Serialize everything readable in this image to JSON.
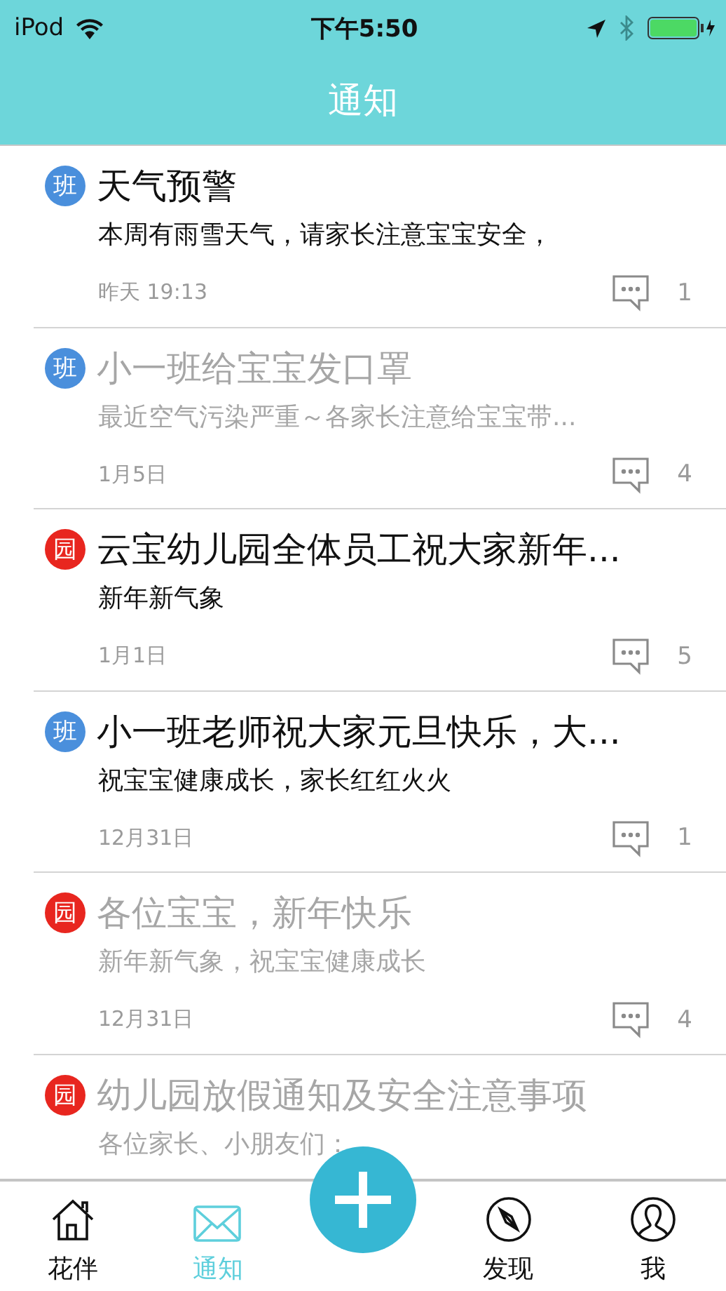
{
  "status_bar": {
    "carrier": "iPod",
    "time": "下午5:50"
  },
  "header": {
    "title": "通知"
  },
  "notices": [
    {
      "badge": "班",
      "color": "#4a8fdc",
      "read": false,
      "title": "天气预警",
      "body": "本周有雨雪天气，请家长注意宝宝安全，",
      "date": "昨天 19:13",
      "comments": "1"
    },
    {
      "badge": "班",
      "color": "#4a8fdc",
      "read": true,
      "title": "小一班给宝宝发口罩",
      "body": "最近空气污染严重～各家长注意给宝宝带...",
      "date": "1月5日",
      "comments": "4"
    },
    {
      "badge": "园",
      "color": "#e8261f",
      "read": false,
      "title": "云宝幼儿园全体员工祝大家新年...",
      "body": "新年新气象",
      "date": "1月1日",
      "comments": "5"
    },
    {
      "badge": "班",
      "color": "#4a8fdc",
      "read": false,
      "title": "小一班老师祝大家元旦快乐，大...",
      "body": "祝宝宝健康成长，家长红红火火",
      "date": "12月31日",
      "comments": "1"
    },
    {
      "badge": "园",
      "color": "#e8261f",
      "read": true,
      "title": "各位宝宝，新年快乐",
      "body": "新年新气象，祝宝宝健康成长",
      "date": "12月31日",
      "comments": "4"
    },
    {
      "badge": "园",
      "color": "#e8261f",
      "read": true,
      "title": "幼儿园放假通知及安全注意事项",
      "body": "各位家长、小朋友们："
    }
  ],
  "tab_bar": [
    {
      "kind": "home",
      "label": "花伴",
      "selected": false
    },
    {
      "kind": "mail",
      "label": "通知",
      "selected": true
    },
    {
      "kind": "add"
    },
    {
      "kind": "compass",
      "label": "发现",
      "selected": false
    },
    {
      "kind": "user",
      "label": "我",
      "selected": false
    }
  ]
}
